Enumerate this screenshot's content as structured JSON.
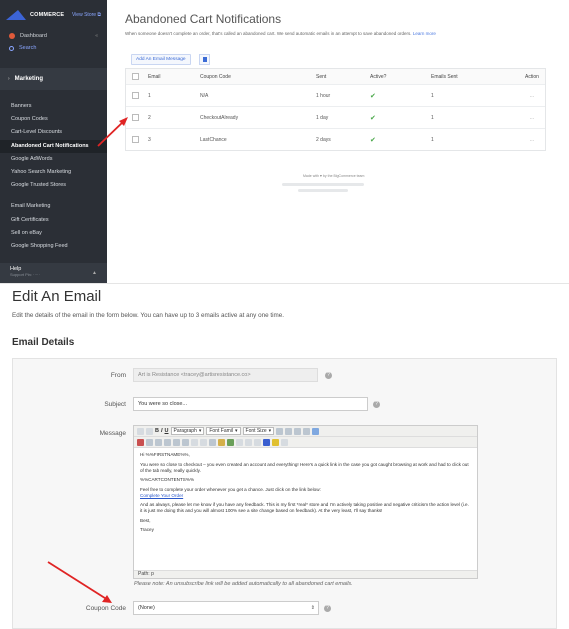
{
  "sidebar": {
    "brand": "COMMERCE",
    "view_store": "View Store ⧉",
    "dashboard": "Dashboard",
    "search": "Search",
    "section": "Marketing",
    "items": [
      {
        "label": "Banners"
      },
      {
        "label": "Coupon Codes"
      },
      {
        "label": "Cart-Level Discounts"
      },
      {
        "label": "Abandoned Cart Notifications"
      },
      {
        "label": "Google AdWords"
      },
      {
        "label": "Yahoo Search Marketing"
      },
      {
        "label": "Google Trusted Stores"
      }
    ],
    "items2": [
      {
        "label": "Email Marketing"
      },
      {
        "label": "Gift Certificates"
      },
      {
        "label": "Sell on eBay"
      },
      {
        "label": "Google Shopping Feed"
      }
    ],
    "help": "Help",
    "help_sub": "Support Pin: ·····"
  },
  "notifications": {
    "title": "Abandoned Cart Notifications",
    "description": "When someone doesn't complete an order, that's called an abandoned cart. We send automatic emails in an attempt to save abandoned orders.",
    "learn_more": "Learn more",
    "add_button": "Add An Email Message",
    "columns": [
      "Email",
      "Coupon Code",
      "Sent",
      "Active?",
      "Emails Sent",
      "Action"
    ],
    "rows": [
      {
        "email": "1",
        "coupon": "N/A",
        "sent": "1 hour",
        "active": "✔",
        "emails_sent": "1",
        "action": "..."
      },
      {
        "email": "2",
        "coupon": "CheckoutAlready",
        "sent": "1 day",
        "active": "✔",
        "emails_sent": "1",
        "action": "..."
      },
      {
        "email": "3",
        "coupon": "LastChance",
        "sent": "2 days",
        "active": "✔",
        "emails_sent": "1",
        "action": "..."
      }
    ],
    "footer": "Made with ♥ by the BigCommerce team"
  },
  "edit": {
    "title": "Edit An Email",
    "description": "Edit the details of the email in the form below. You can have up to 3 emails active at any one time.",
    "section": "Email Details",
    "from_label": "From",
    "from_value": "Art is Resistance <tracey@artisresistance.co>",
    "subject_label": "Subject",
    "subject_value": "You were so close...",
    "message_label": "Message",
    "toolbar": {
      "paragraph": "Paragraph",
      "font_family": "Font Famil",
      "font_size": "Font Size"
    },
    "message": {
      "greeting": "Hi %%FIRSTNAME%%,",
      "p1": "You were so close to checkout – you even created an account and everything! Here's a quick link in the case you got caught browsing at work and had to click out of the tab really, really quickly.",
      "p2": "%%CARTCONTENTS%%",
      "p3": "Feel free to complete your order whenever you get a chance. Just click on the link below:",
      "link": "Complete Your Order",
      "p4": "And as always, please let me know if you have any feedback. This is my first *real* store and I'm actively taking positive and negative criticism the action level (i.e. it is just me doing this and you will almost 100% see a site change based on feedback). At the very least, I'll say thanks!",
      "p5": "Best,",
      "p6": "Tracey"
    },
    "path": "Path: p",
    "note": "Please note: An unsubscribe link will be added automatically to all abandoned cart emails.",
    "coupon_label": "Coupon Code",
    "coupon_value": "(None)"
  }
}
